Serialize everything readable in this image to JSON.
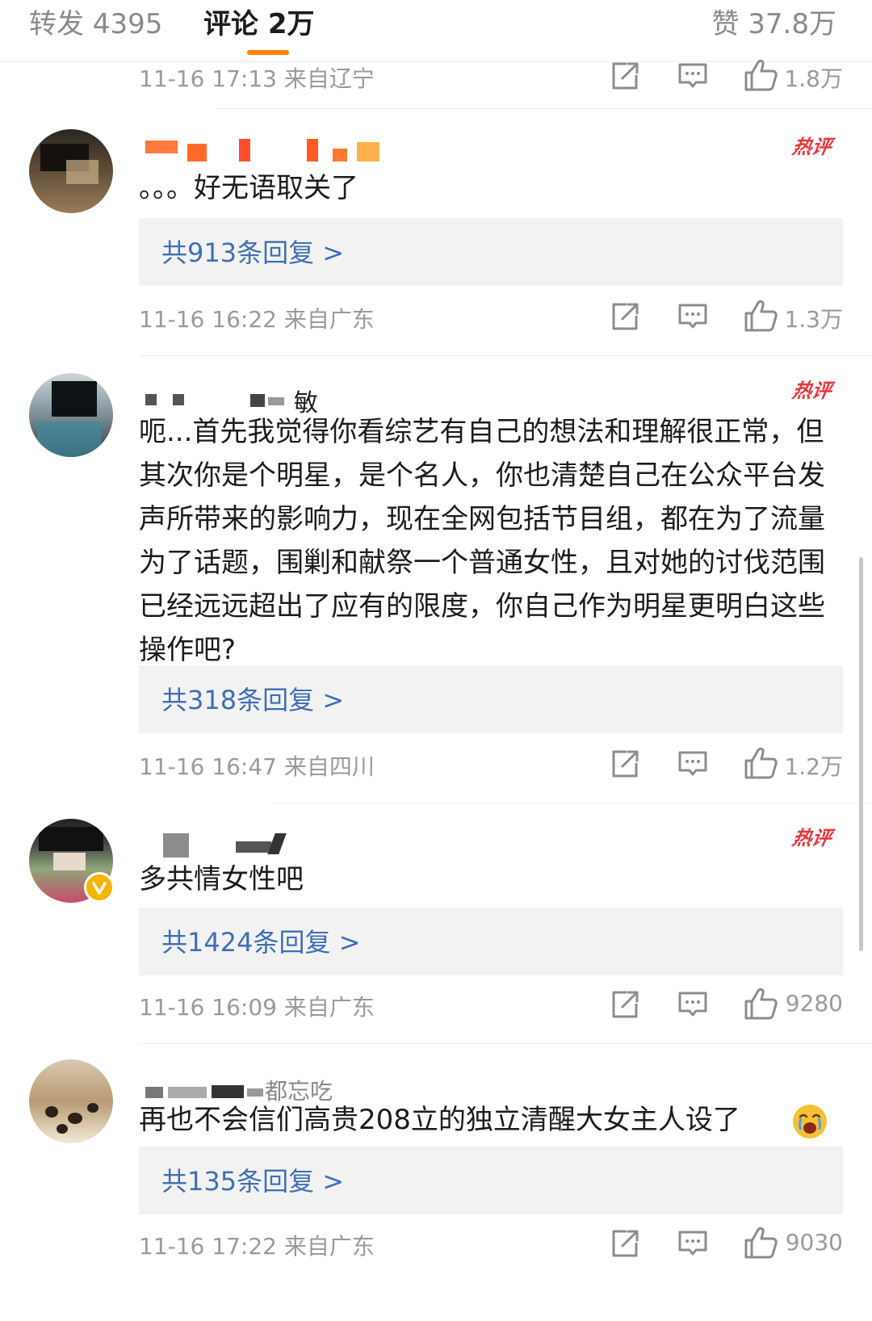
{
  "tabs": {
    "repost": "转发 4395",
    "comments": "评论 2万",
    "likes": "赞 37.8万"
  },
  "icons": {
    "share": "share-icon",
    "comment": "comment-icon",
    "like": "thumbs-up-icon",
    "emoji": "crying-face-icon"
  },
  "colors": {
    "accent": "#ff8200",
    "link": "#3f6fb3",
    "hot": "#e8353a",
    "meta": "#9a9a9a"
  },
  "top_meta": {
    "time": "11-16 17:13 来自辽宁",
    "likes": "1.8万"
  },
  "comments": [
    {
      "username": "",
      "hot_badge": "热评",
      "text": "。。。好无语取关了",
      "replies": "共913条回复 >",
      "time": "11-16 16:22 来自广东",
      "likes": "1.3万"
    },
    {
      "username": "敏",
      "hot_badge": "热评",
      "text": "呃...首先我觉得你看综艺有自己的想法和理解很正常，但其次你是个明星，是个名人，你也清楚自己在公众平台发声所带来的影响力，现在全网包括节目组，都在为了流量为了话题，围剿和献祭一个普通女性，且对她的讨伐范围已经远远超出了应有的限度，你自己作为明星更明白这些操作吧?",
      "replies": "共318条回复 >",
      "time": "11-16 16:47 来自四川",
      "likes": "1.2万"
    },
    {
      "username": "",
      "hot_badge": "热评",
      "text": "多共情女性吧",
      "replies": "共1424条回复 >",
      "time": "11-16 16:09 来自广东",
      "likes": "9280"
    },
    {
      "username": "都忘吃",
      "hot_badge": "",
      "text": "再也不会信们高贵208立的独立清醒大女主人设了",
      "replies": "共135条回复 >",
      "time": "11-16 17:22 来自广东",
      "likes": "9030"
    }
  ]
}
